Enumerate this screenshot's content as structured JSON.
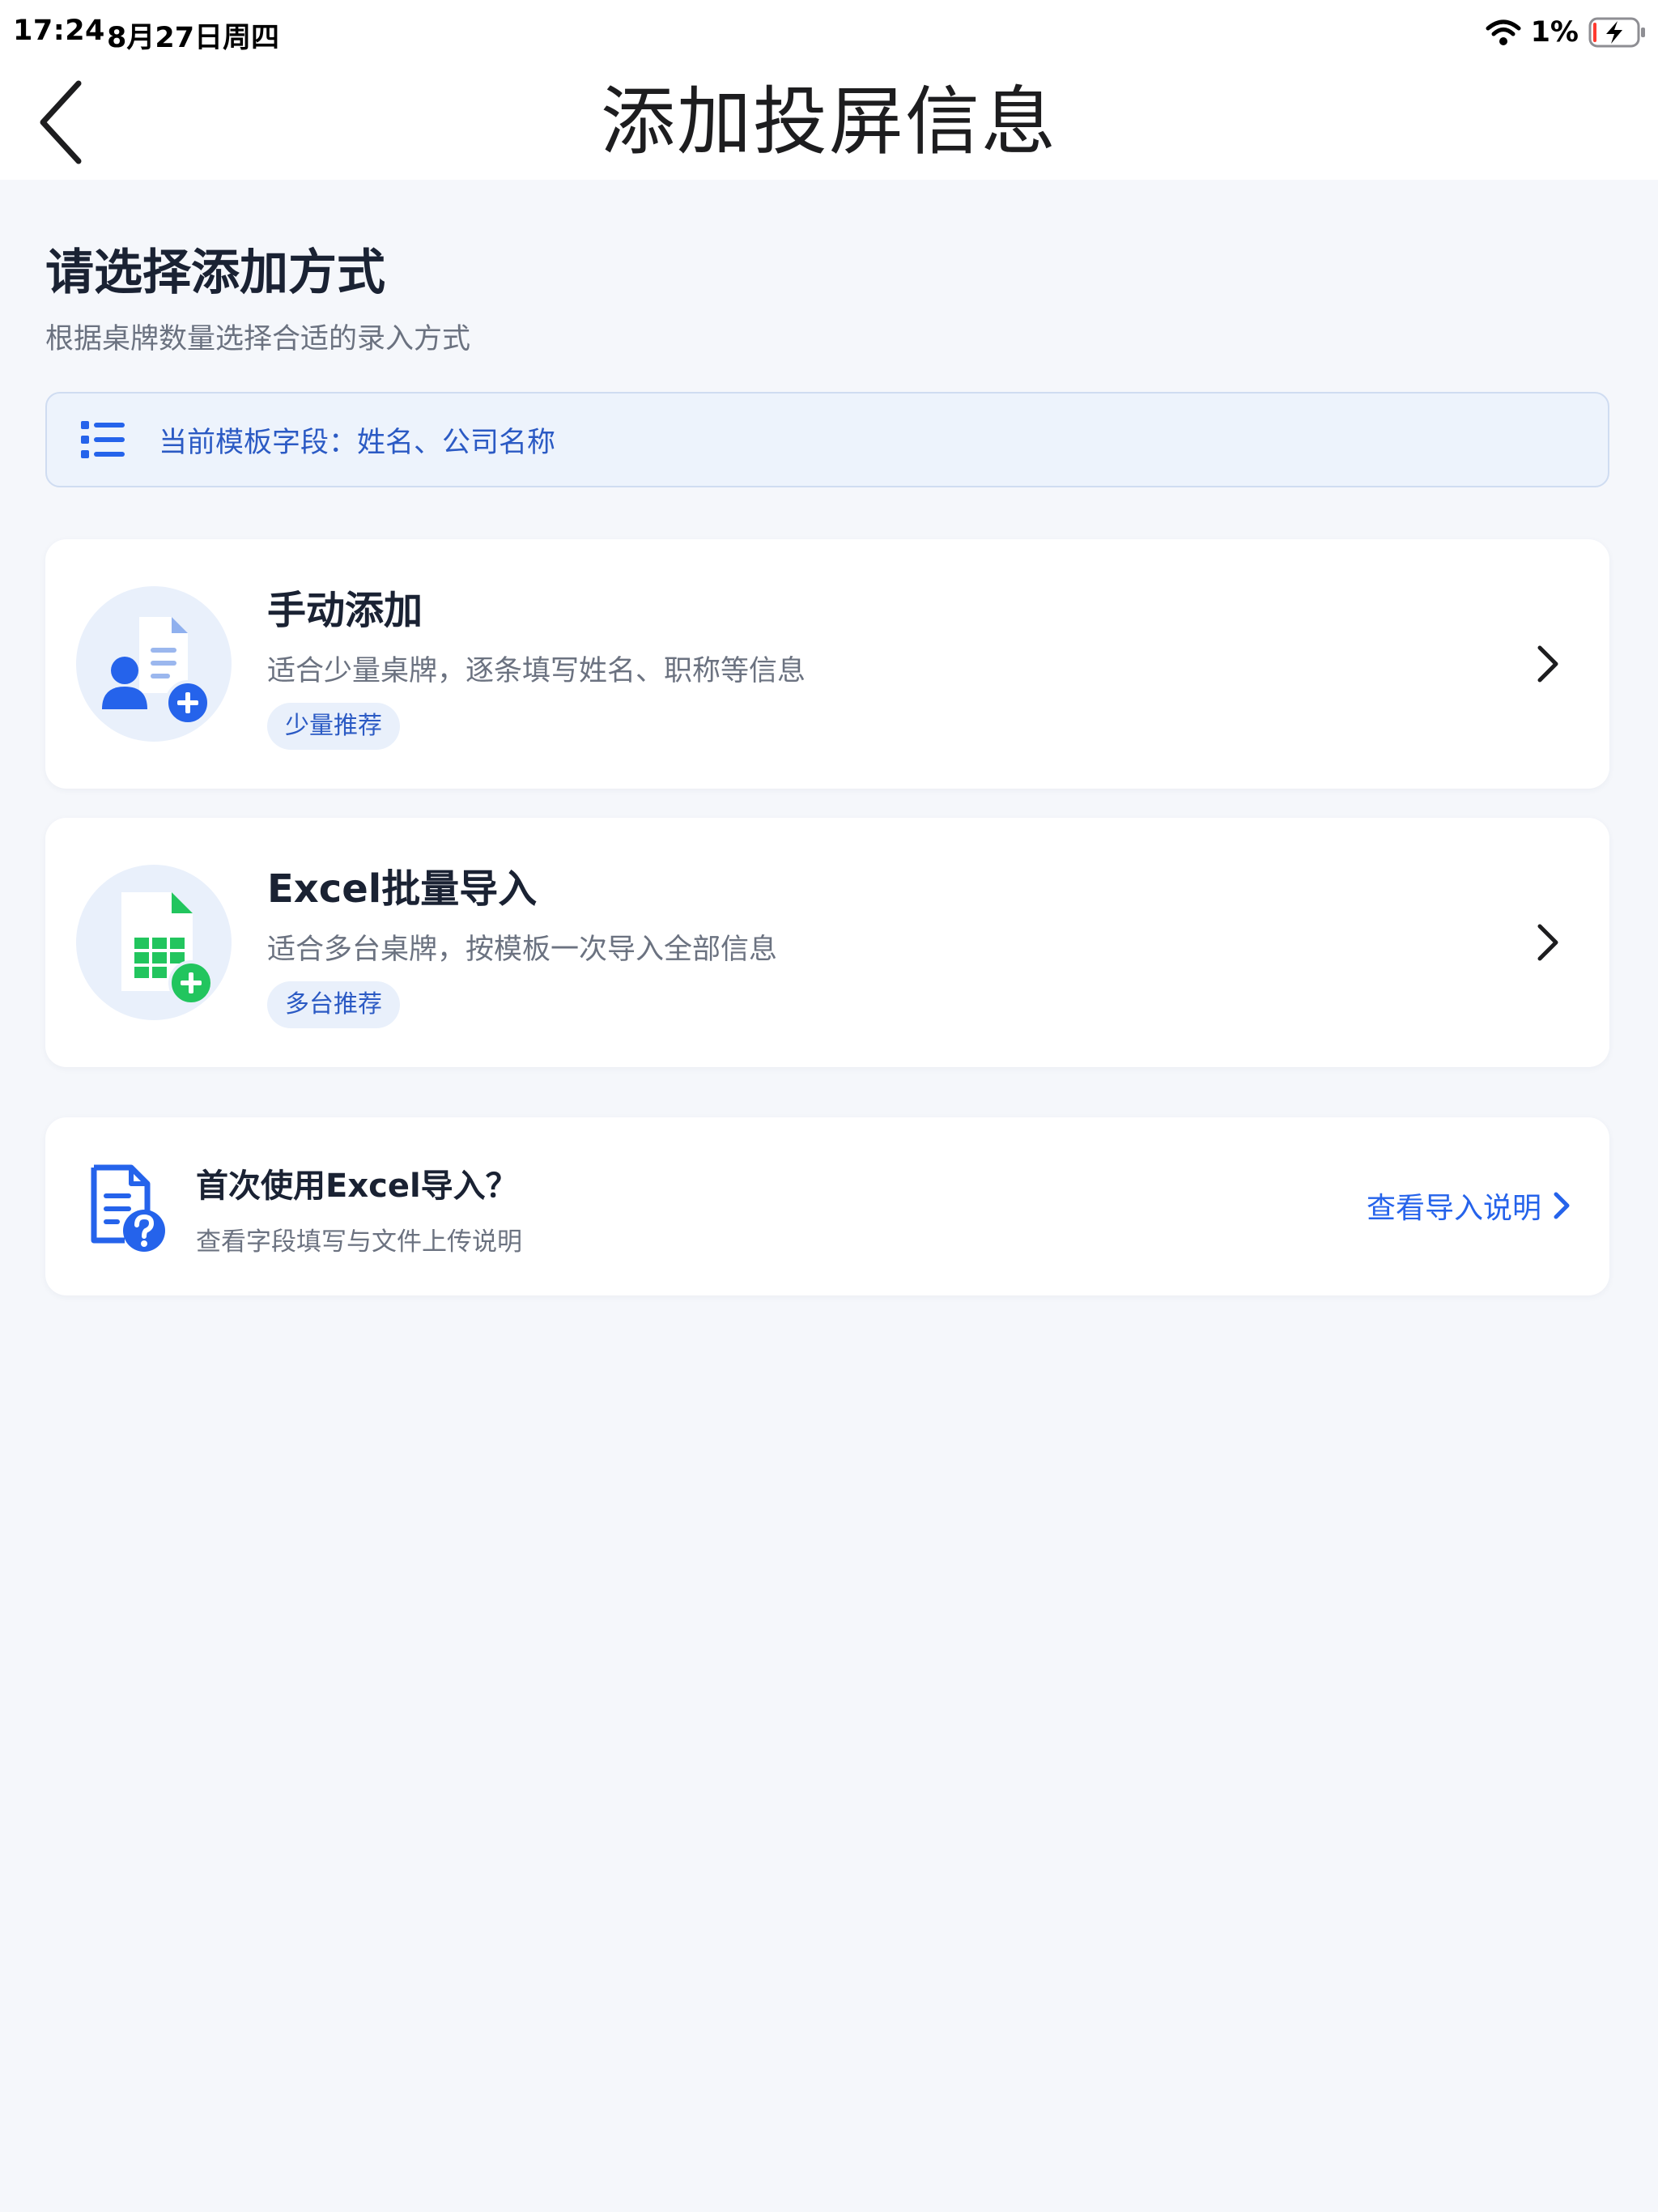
{
  "status_bar": {
    "time": "17:24",
    "date": "8月27日周四",
    "battery": "1%"
  },
  "nav": {
    "title": "添加投屏信息"
  },
  "section": {
    "title": "请选择添加方式",
    "subtitle": "根据桌牌数量选择合适的录入方式"
  },
  "fields_banner": {
    "text": "当前模板字段：姓名、公司名称"
  },
  "options": [
    {
      "title": "手动添加",
      "description": "适合少量桌牌，逐条填写姓名、职称等信息",
      "badge": "少量推荐",
      "icon": "add-person-document-icon"
    },
    {
      "title": "Excel批量导入",
      "description": "适合多台桌牌，按模板一次导入全部信息",
      "badge": "多台推荐",
      "icon": "spreadsheet-add-icon"
    }
  ],
  "help": {
    "title": "首次使用Excel导入？",
    "description": "查看字段填写与文件上传说明",
    "link_label": "查看导入说明"
  },
  "colors": {
    "accent": "#2563eb",
    "green": "#22c55e",
    "background": "#f5f7fb",
    "banner_bg": "#edf3fc"
  }
}
